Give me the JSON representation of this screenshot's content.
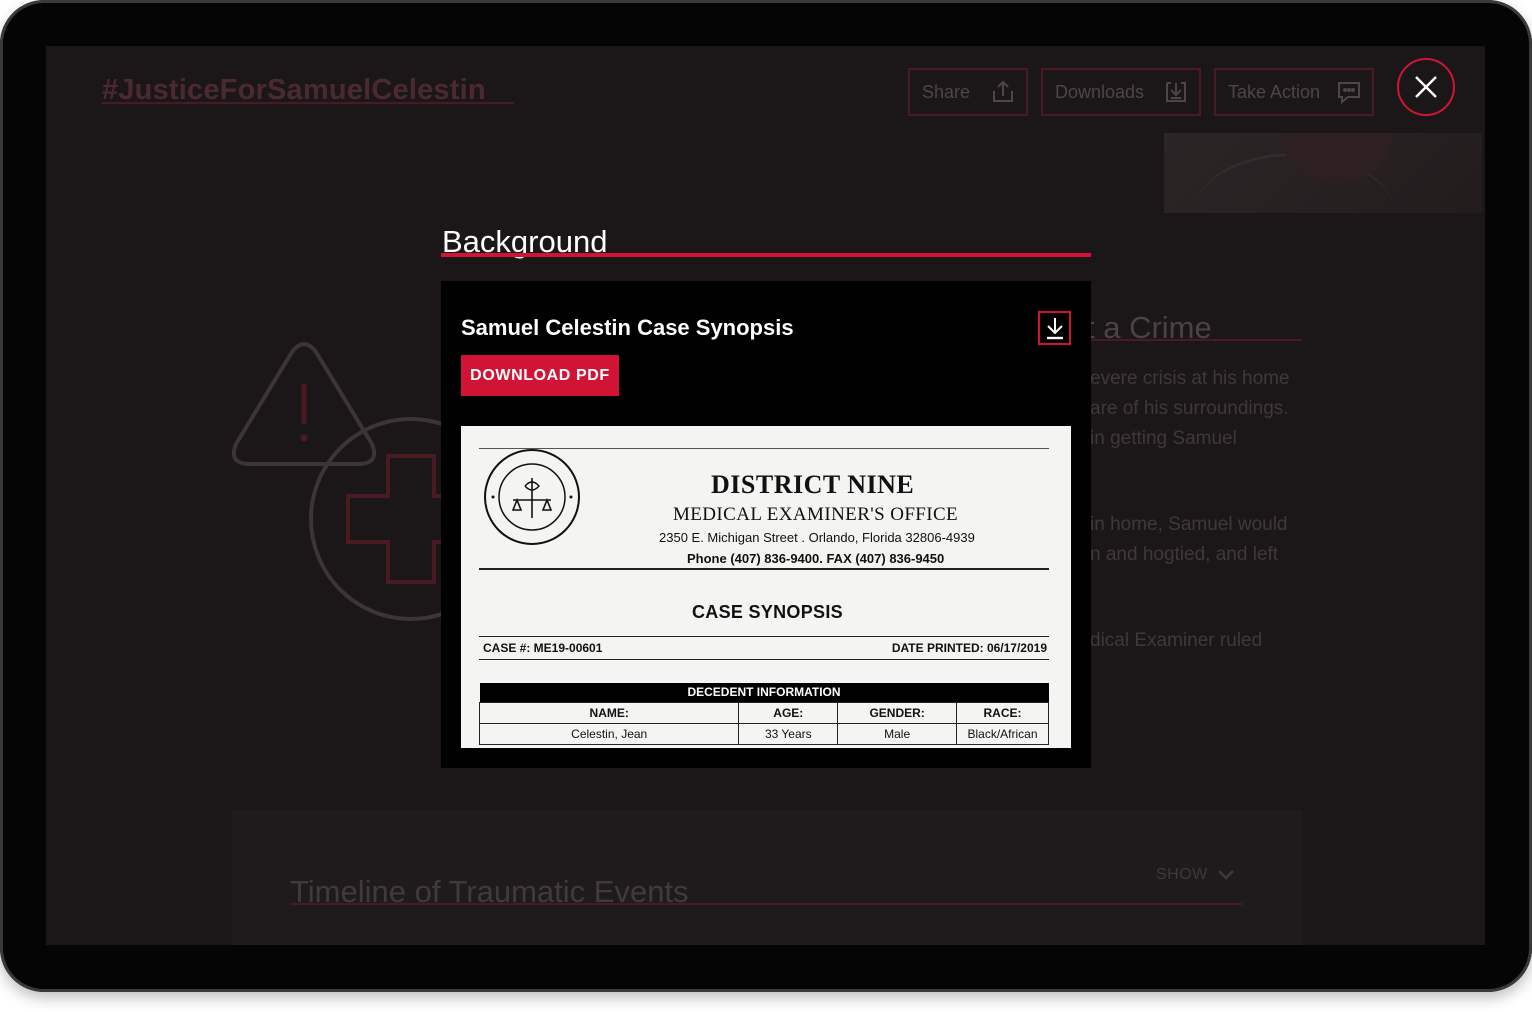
{
  "page": {
    "hashtag": "#JusticeForSamuelCelestin",
    "top_buttons": {
      "share": "Share",
      "downloads": "Downloads",
      "take_action": "Take Action"
    },
    "crime_heading": "t a Crime",
    "crime_text_lines": [
      "evere crisis at his home",
      "are of his surroundings.",
      "in getting Samuel",
      "in home, Samuel would",
      "n and hogtied, and left",
      "dical Examiner ruled"
    ],
    "timeline": {
      "title": "Timeline of Traumatic Events",
      "show_label": "SHOW"
    }
  },
  "modal": {
    "section_heading": "Background",
    "title": "Samuel Celestin Case Synopsis",
    "download_button": "DOWNLOAD PDF",
    "document": {
      "agency": "DISTRICT NINE",
      "office": "MEDICAL EXAMINER'S OFFICE",
      "address": "2350 E. Michigan Street . Orlando, Florida 32806-4939",
      "phone": "Phone (407) 836-9400.  FAX (407) 836-9450",
      "heading": "CASE SYNOPSIS",
      "case_number": "CASE #: ME19-00601",
      "date_printed": "DATE PRINTED: 06/17/2019",
      "table_title": "DECEDENT INFORMATION",
      "columns": [
        "NAME:",
        "AGE:",
        "GENDER:",
        "RACE:"
      ],
      "row": [
        "Celestin, Jean",
        "33 Years",
        "Male",
        "Black/African"
      ]
    }
  },
  "colors": {
    "accent": "#d11436",
    "screen_bg": "#1b1718",
    "modal_bg": "#000000"
  },
  "icons": {
    "share": "share-icon",
    "downloads": "download-icon",
    "take_action": "chat-icon",
    "close": "close-icon",
    "warning": "warning-icon",
    "medical": "medical-cross-icon",
    "chevron": "chevron-down-icon"
  }
}
